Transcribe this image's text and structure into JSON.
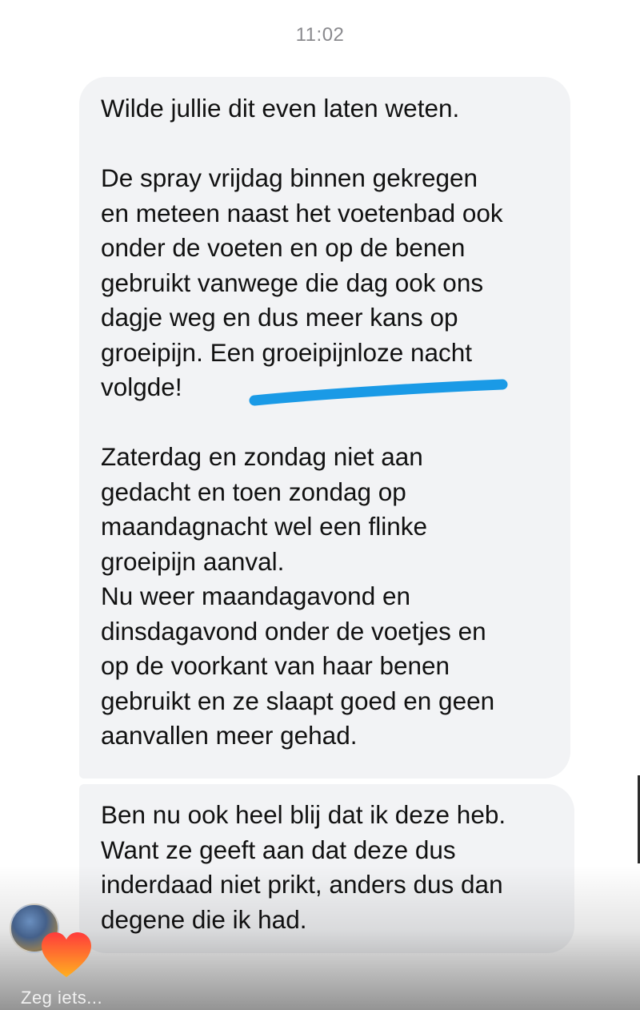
{
  "status": {
    "time": "11:02"
  },
  "message_1": {
    "para_1": "Wilde jullie dit even laten weten.",
    "para_2": [
      "De spray vrijdag binnen gekregen",
      "en meteen naast het voetenbad ook",
      "onder de voeten en op de benen",
      "gebruikt vanwege die dag ook ons",
      "dagje weg en dus meer kans op",
      "groeipijn. Een groeipijnloze nacht",
      "volgde!"
    ],
    "para_3": [
      "Zaterdag en zondag niet aan",
      "gedacht en toen zondag op",
      "maandagnacht wel een flinke",
      "groeipijn aanval."
    ],
    "para_4": [
      "Nu weer maandagavond en",
      "dinsdagavond onder de voetjes en",
      "op de voorkant van haar benen",
      "gebruikt en ze slaapt goed en geen",
      "aanvallen meer gehad."
    ]
  },
  "message_2": {
    "lines": [
      "Ben nu ook heel blij dat ik deze heb.",
      "Want ze geeft aan dat deze dus",
      "inderdaad niet prikt, anders dus dan",
      "degene die ik had."
    ]
  },
  "annotation": {
    "underline_color": "#1a9ae6"
  },
  "reaction": {
    "icon": "heart-icon",
    "gradient_top": "#ff3b3b",
    "gradient_bottom": "#ffb020"
  },
  "composer": {
    "placeholder": "Zeg iets..."
  }
}
